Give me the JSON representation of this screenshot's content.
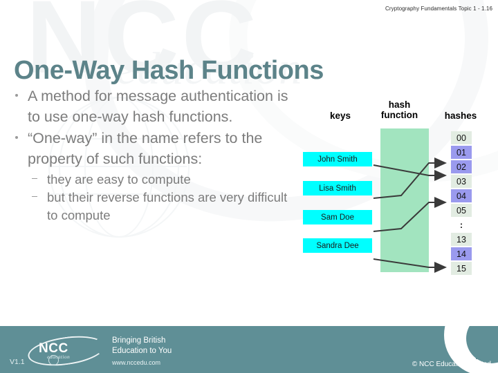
{
  "header": {
    "course_reference": "Cryptography Fundamentals  Topic 1 - 1.16"
  },
  "title": "One-Way Hash Functions",
  "content": {
    "bullets": [
      {
        "text": "A method for message authentication is to use one-way hash functions.",
        "subitems": []
      },
      {
        "text": "“One-way” in the name refers to the property of such functions:",
        "subitems": [
          "they are easy to compute",
          "but their reverse functions are very difficult to compute"
        ]
      }
    ]
  },
  "diagram": {
    "labels": {
      "keys": "keys",
      "hash_function_line1": "hash",
      "hash_function_line2": "function",
      "hashes": "hashes"
    },
    "keys": [
      {
        "name": "John Smith",
        "maps_to": "02"
      },
      {
        "name": "Lisa Smith",
        "maps_to": "01"
      },
      {
        "name": "Sam Doe",
        "maps_to": "04"
      },
      {
        "name": "Sandra Dee",
        "maps_to": "14"
      }
    ],
    "hash_cells": [
      {
        "value": "00",
        "state": "empty"
      },
      {
        "value": "01",
        "state": "filled"
      },
      {
        "value": "02",
        "state": "filled"
      },
      {
        "value": "03",
        "state": "empty"
      },
      {
        "value": "04",
        "state": "filled"
      },
      {
        "value": "05",
        "state": "empty"
      },
      {
        "value": ":",
        "state": "ellipsis"
      },
      {
        "value": "13",
        "state": "empty"
      },
      {
        "value": "14",
        "state": "filled"
      },
      {
        "value": "15",
        "state": "empty"
      }
    ],
    "colors": {
      "key_box": "#00ffff",
      "hash_function_band": "#a2e4bf",
      "hash_cell_empty": "#e2ece2",
      "hash_cell_filled": "#9a9aee",
      "wire": "#3a3a3a"
    }
  },
  "footer": {
    "version": "V1.1",
    "logo_word": "NCC",
    "logo_subword": "education",
    "tagline_line1": "Bringing British",
    "tagline_line2": "Education to You",
    "url": "www.nccedu.com",
    "copyright": "©  NCC Education Limited",
    "band_color": "#5f8f96"
  },
  "watermark": {
    "word": "NCC",
    "subword": "education"
  },
  "theme": {
    "title_color": "#5c8389",
    "body_text_color": "#7c7c7c",
    "background": "#ffffff"
  }
}
